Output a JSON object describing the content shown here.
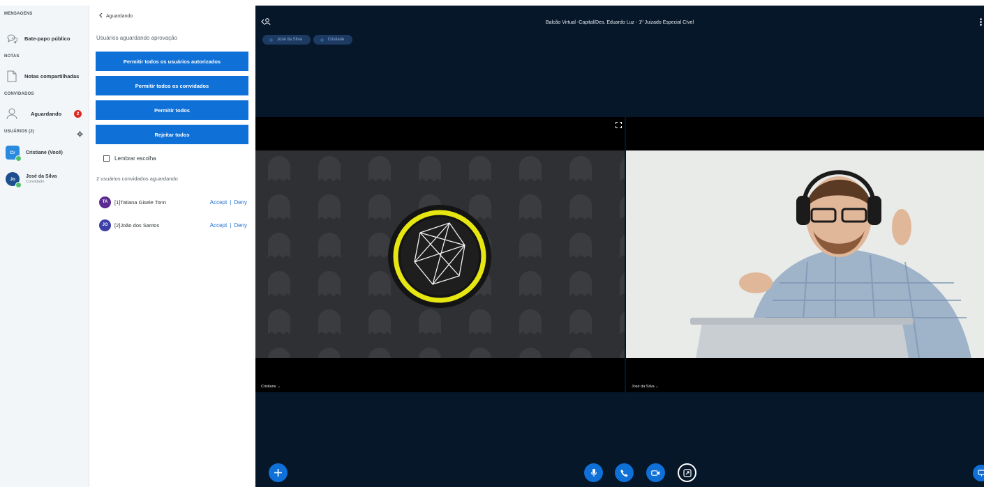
{
  "sidebar": {
    "messages_title": "MENSAGENS",
    "public_chat": "Bate-papo público",
    "notes_title": "NOTAS",
    "shared_notes": "Notas compartilhadas",
    "guests_title": "CONVIDADOS",
    "waiting": "Aguardando",
    "waiting_count": "2",
    "users_title": "USUÁRIOS (2)",
    "users": [
      {
        "initials": "Cr",
        "name": "Cristiane (Você)",
        "role": ""
      },
      {
        "initials": "Jo",
        "name": "José da Silva",
        "role": "Convidado"
      }
    ]
  },
  "waiting_panel": {
    "back_label": "Aguardando",
    "title": "Usuários aguardando aprovação",
    "buttons": {
      "allow_authenticated": "Permitir todos os usuários autorizados",
      "allow_guests": "Permitir todos os convidados",
      "allow_all": "Permitir todos",
      "deny_all": "Rejeitar todos"
    },
    "remember_choice": "Lembrar escolha",
    "waiting_count_text": "2 usuários convidados aguardando",
    "guests": [
      {
        "initials": "TA",
        "name": "[1]Tatiana Gisele Tonn",
        "accept": "Accept",
        "separator": "|",
        "deny": "Deny"
      },
      {
        "initials": "JO",
        "name": "[2]João dos Santos",
        "accept": "Accept",
        "separator": "|",
        "deny": "Deny"
      }
    ]
  },
  "meeting": {
    "title": "Balcão Virtual -Capital/Des. Eduardo Luz - 1º Juizado Especial Cível",
    "talkers": [
      "José da Silva",
      "Cristiane"
    ],
    "videos": [
      {
        "name": "Cristiane ⌄"
      },
      {
        "name": "José da Silva ⌄"
      }
    ]
  },
  "colors": {
    "accent": "#0f70d7",
    "meeting_bg": "#06172a",
    "badge": "#df2721"
  }
}
